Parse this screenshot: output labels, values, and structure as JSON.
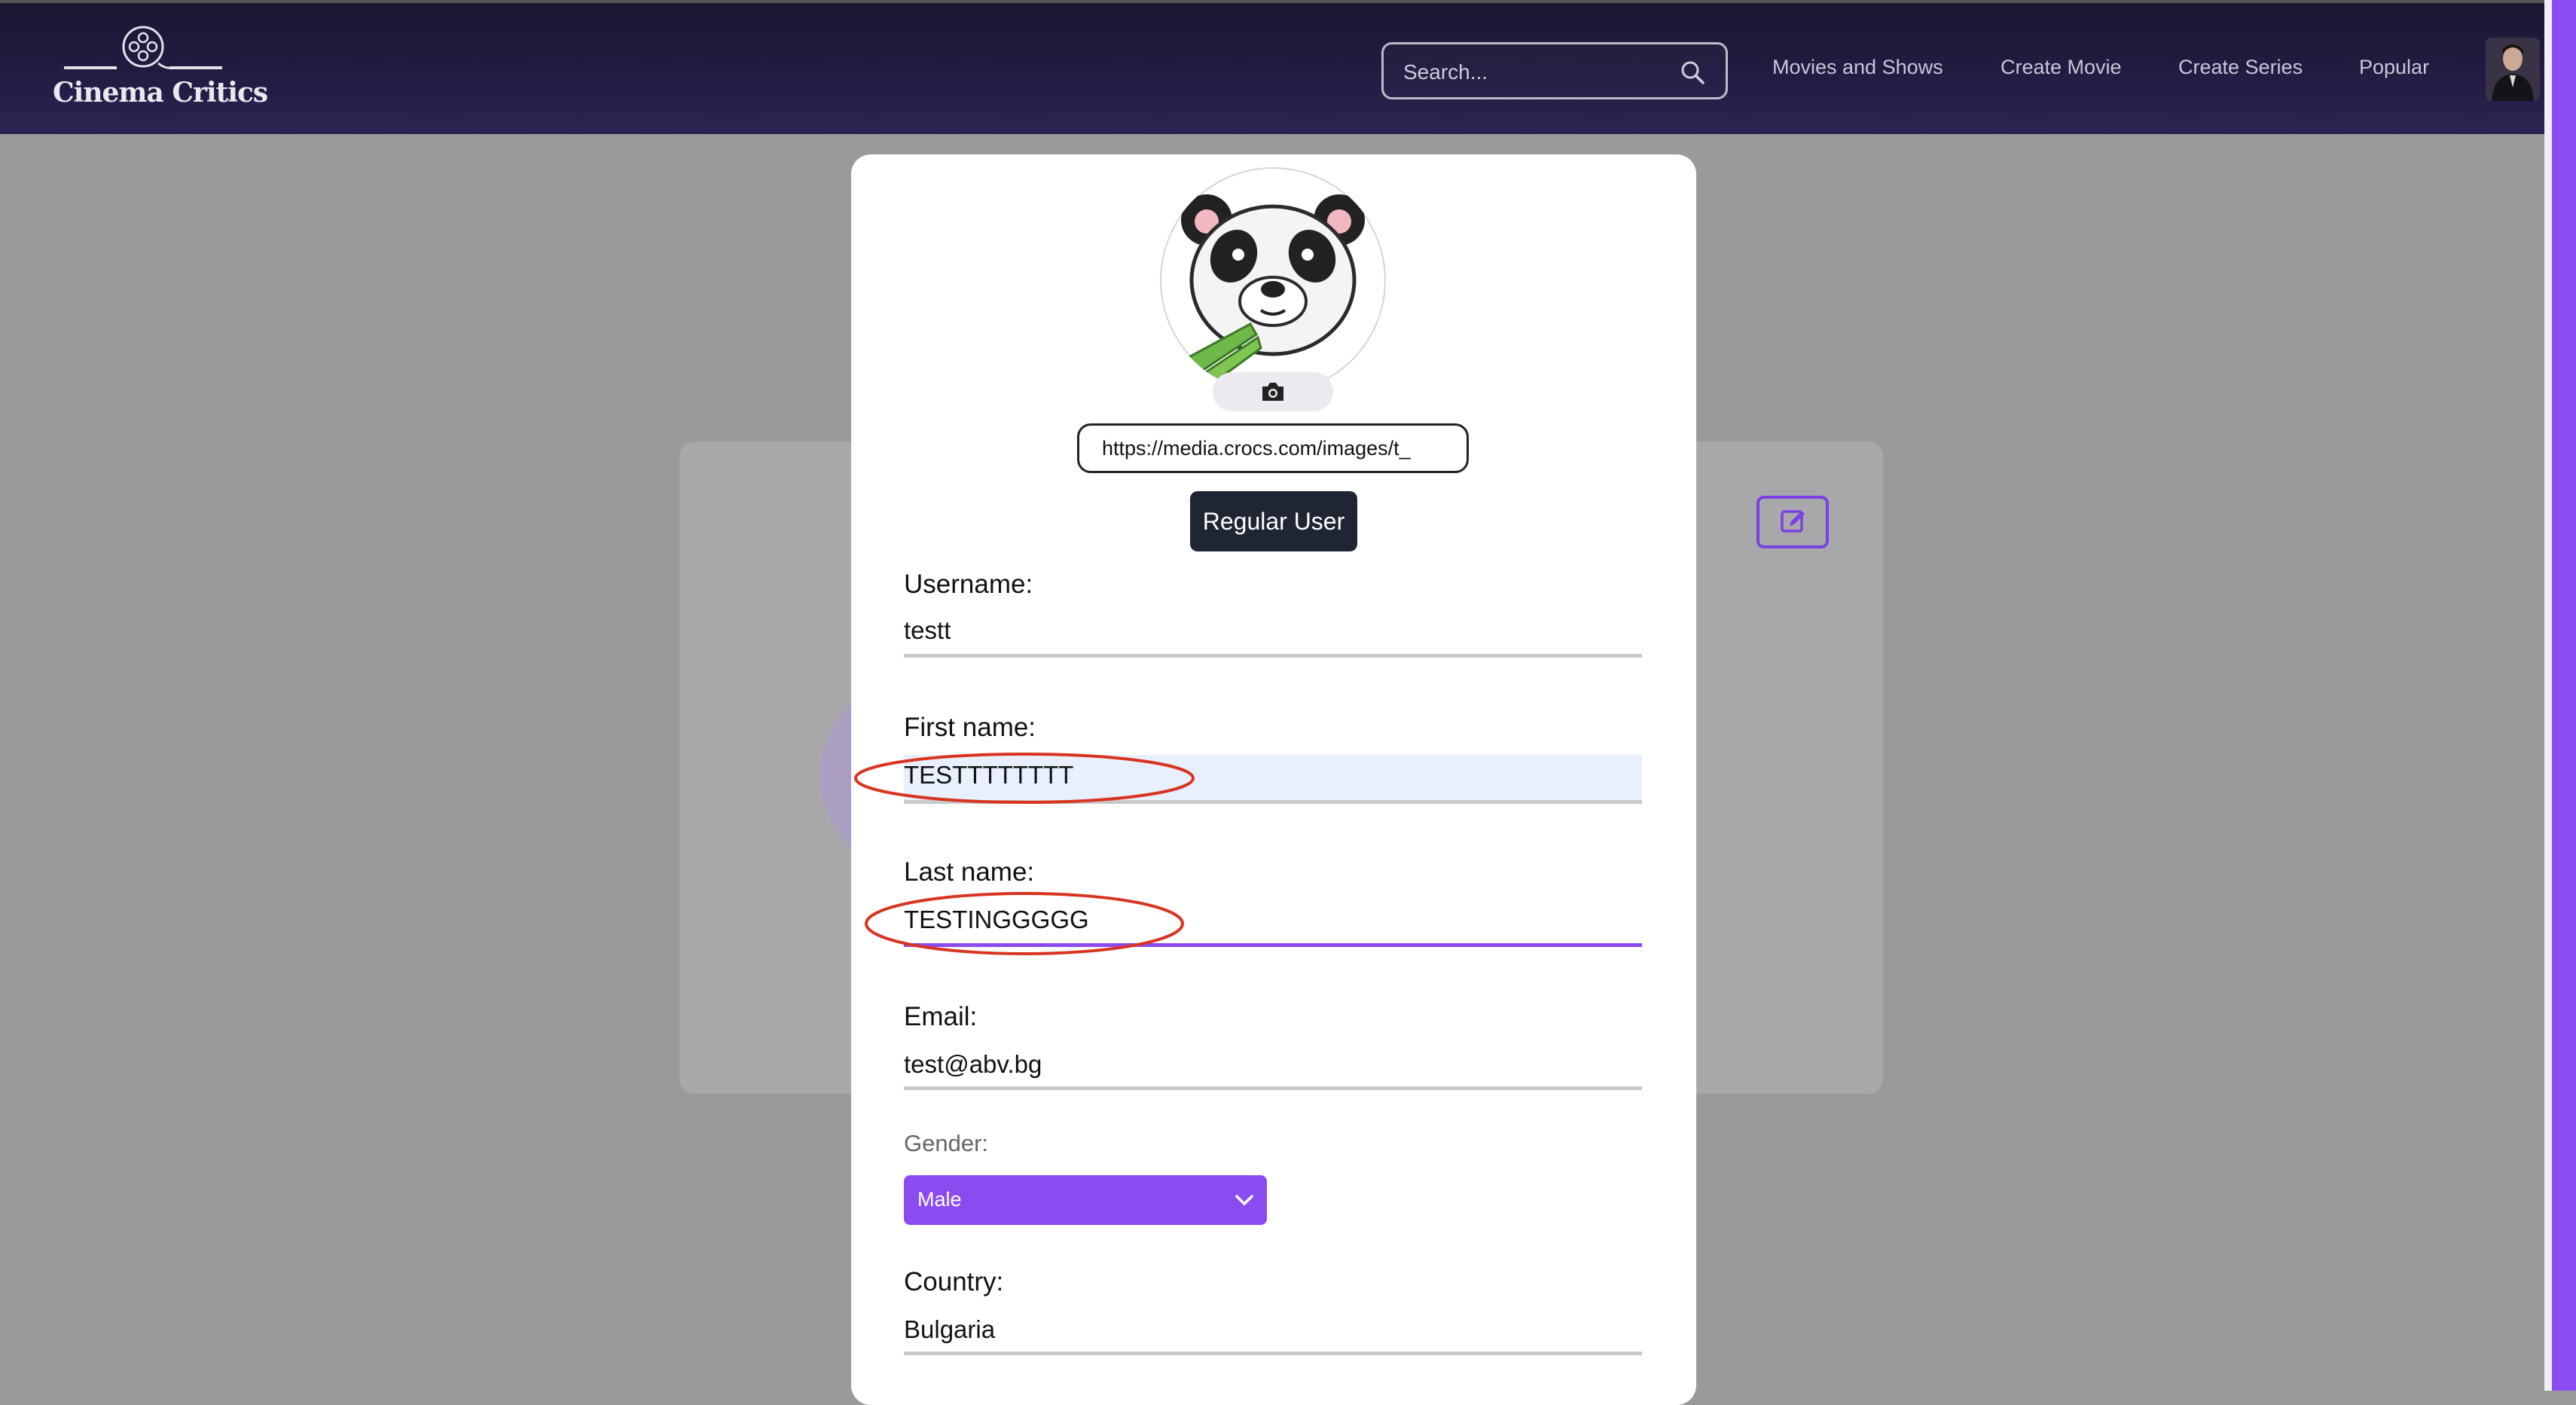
{
  "app": {
    "logo_text": "Cinema Critics",
    "logo_icon": "film-reel-icon"
  },
  "header": {
    "search_placeholder": "Search...",
    "nav": [
      {
        "label": "Movies and Shows"
      },
      {
        "label": "Create Movie"
      },
      {
        "label": "Create Series"
      },
      {
        "label": "Popular"
      }
    ]
  },
  "profile_modal": {
    "avatar_icon": "panda-avatar",
    "camera_icon": "camera-icon",
    "image_url": "https://media.crocs.com/images/t_",
    "role": "Regular User",
    "fields": {
      "username": {
        "label": "Username:",
        "value": "testt"
      },
      "first_name": {
        "label": "First name:",
        "value": "TESTTTTTTTT"
      },
      "last_name": {
        "label": "Last name:",
        "value": "TESTINGGGGG"
      },
      "email": {
        "label": "Email:",
        "value": "test@abv.bg"
      },
      "gender": {
        "label": "Gender:",
        "value": "Male"
      },
      "country": {
        "label": "Country:",
        "value": "Bulgaria"
      }
    }
  },
  "colors": {
    "accent": "#8a4cf0",
    "navbar": "#241c44",
    "badge": "#1f2533",
    "annotation": "#d9341f"
  }
}
